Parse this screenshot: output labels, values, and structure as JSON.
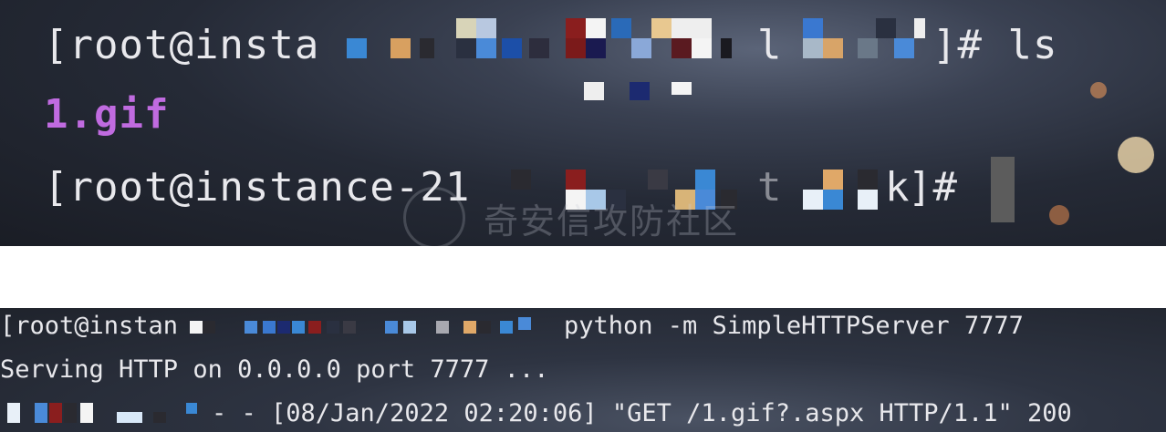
{
  "top_terminal": {
    "line1_prefix": "[root@insta",
    "line1_mid": "l",
    "line1_suffix": "]# ls",
    "output_file": "1.gif",
    "line3_prefix": "[root@instance-21",
    "line3_mid1": "t",
    "line3_mid2": "k",
    "line3_suffix": "]#"
  },
  "bottom_terminal": {
    "prompt_prefix": "[root@instan",
    "command": "python -m SimpleHTTPServer 7777",
    "serving_line": "Serving HTTP on 0.0.0.0 port 7777 ...",
    "log_line": "- - [08/Jan/2022 02:20:06] \"GET /1.gif?.aspx HTTP/1.1\" 200"
  },
  "watermark": "奇安信攻防社区"
}
